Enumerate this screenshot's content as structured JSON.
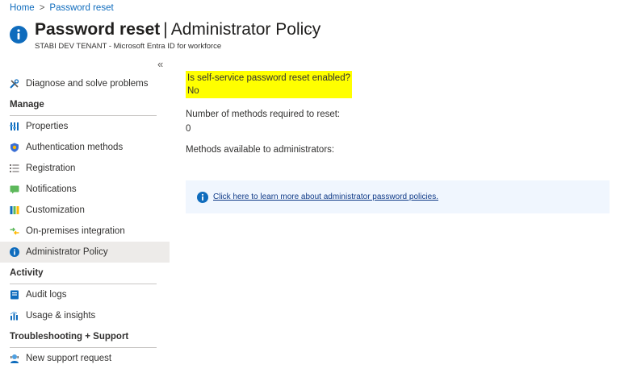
{
  "breadcrumb": {
    "home": "Home",
    "separator": ">",
    "current": "Password reset"
  },
  "header": {
    "title_strong": "Password reset",
    "title_separator": "|",
    "title_light": "Administrator Policy",
    "more": "···",
    "subtitle": "STABI DEV TENANT - Microsoft Entra ID for workforce"
  },
  "sidebar": {
    "collapse": "«",
    "diagnose": "Diagnose and solve problems",
    "manage_header": "Manage",
    "manage_items": [
      {
        "label": "Properties",
        "icon": "properties-icon"
      },
      {
        "label": "Authentication methods",
        "icon": "shield-icon"
      },
      {
        "label": "Registration",
        "icon": "list-icon"
      },
      {
        "label": "Notifications",
        "icon": "message-icon"
      },
      {
        "label": "Customization",
        "icon": "palette-icon"
      },
      {
        "label": "On-premises integration",
        "icon": "sync-icon"
      },
      {
        "label": "Administrator Policy",
        "icon": "info-icon",
        "selected": true
      }
    ],
    "activity_header": "Activity",
    "activity_items": [
      {
        "label": "Audit logs",
        "icon": "log-icon"
      },
      {
        "label": "Usage & insights",
        "icon": "chart-icon"
      }
    ],
    "support_header": "Troubleshooting + Support",
    "support_items": [
      {
        "label": "New support request",
        "icon": "support-icon"
      }
    ]
  },
  "main": {
    "sspr_question": "Is self-service password reset enabled?",
    "sspr_value": "No",
    "methods_required_label": "Number of methods required to reset:",
    "methods_required_value": "0",
    "methods_available_label": "Methods available to administrators:",
    "info_link": "Click here to learn more about administrator password policies."
  },
  "colors": {
    "accent": "#0f6cbd",
    "highlight": "#ffff00",
    "banner_bg": "#f0f6fe",
    "selected_bg": "#edebe9"
  }
}
